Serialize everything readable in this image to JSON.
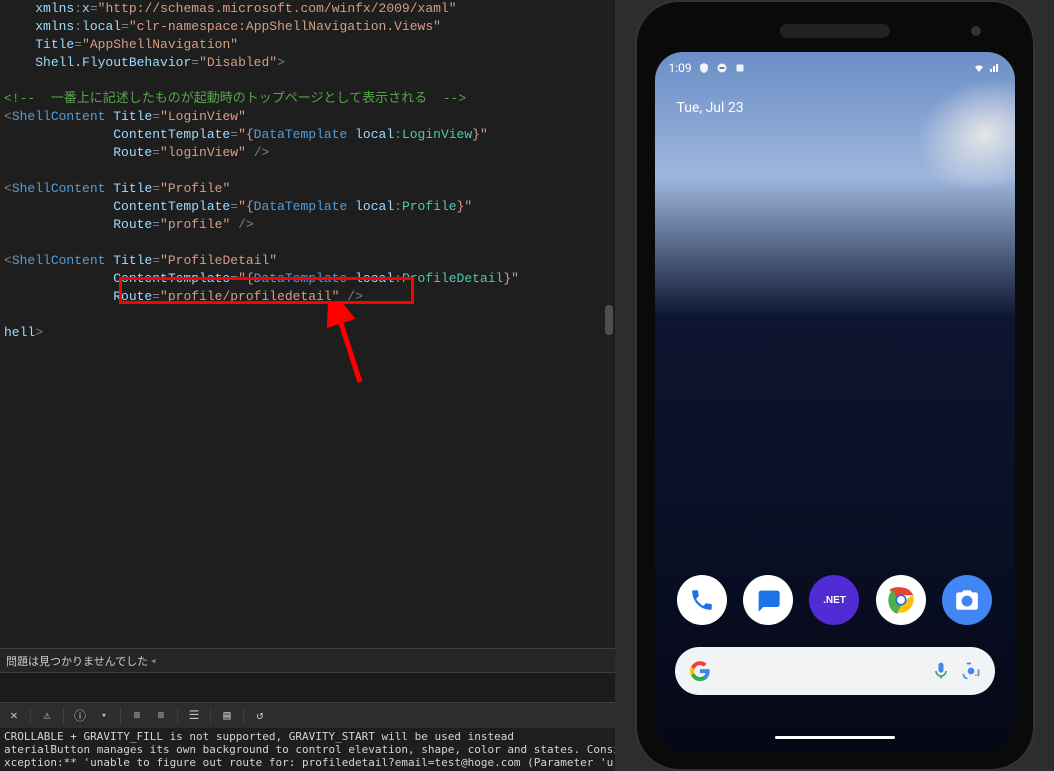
{
  "code": {
    "lines": [
      {
        "indent": "    ",
        "segs": [
          [
            "attr",
            "xmlns"
          ],
          [
            "grey",
            ":"
          ],
          [
            "attr",
            "x"
          ],
          [
            "grey",
            "="
          ],
          [
            "str",
            "\"http://schemas.microsoft.com/winfx/2009/xaml\""
          ]
        ]
      },
      {
        "indent": "    ",
        "segs": [
          [
            "attr",
            "xmlns"
          ],
          [
            "grey",
            ":"
          ],
          [
            "attr",
            "local"
          ],
          [
            "grey",
            "="
          ],
          [
            "str",
            "\"clr-namespace:AppShellNavigation.Views\""
          ]
        ]
      },
      {
        "indent": "    ",
        "segs": [
          [
            "attr",
            "Title"
          ],
          [
            "grey",
            "="
          ],
          [
            "str",
            "\"AppShellNavigation\""
          ]
        ]
      },
      {
        "indent": "    ",
        "segs": [
          [
            "attr",
            "Shell.FlyoutBehavior"
          ],
          [
            "grey",
            "="
          ],
          [
            "str",
            "\"Disabled\""
          ],
          [
            "grey",
            ">"
          ]
        ]
      },
      {
        "indent": "",
        "segs": []
      },
      {
        "indent": "",
        "segs": [
          [
            "comment",
            "<!--  一番上に記述したものが起動時のトップページとして表示される  -->"
          ]
        ]
      },
      {
        "indent": "",
        "segs": [
          [
            "grey",
            "<"
          ],
          [
            "blue",
            "ShellContent"
          ],
          [
            "white",
            " "
          ],
          [
            "attr",
            "Title"
          ],
          [
            "grey",
            "="
          ],
          [
            "str",
            "\"LoginView\""
          ]
        ]
      },
      {
        "indent": "              ",
        "segs": [
          [
            "attr",
            "ContentTemplate"
          ],
          [
            "grey",
            "="
          ],
          [
            "str",
            "\"{"
          ],
          [
            "blue",
            "DataTemplate"
          ],
          [
            "white",
            " "
          ],
          [
            "attr",
            "local"
          ],
          [
            "grey",
            ":"
          ],
          [
            "teal",
            "LoginView"
          ],
          [
            "str",
            "}\""
          ]
        ]
      },
      {
        "indent": "              ",
        "segs": [
          [
            "attr",
            "Route"
          ],
          [
            "grey",
            "="
          ],
          [
            "str",
            "\"loginView\""
          ],
          [
            "white",
            " "
          ],
          [
            "grey",
            "/>"
          ]
        ]
      },
      {
        "indent": "",
        "segs": []
      },
      {
        "indent": "",
        "segs": [
          [
            "grey",
            "<"
          ],
          [
            "blue",
            "ShellContent"
          ],
          [
            "white",
            " "
          ],
          [
            "attr",
            "Title"
          ],
          [
            "grey",
            "="
          ],
          [
            "str",
            "\"Profile\""
          ]
        ]
      },
      {
        "indent": "              ",
        "segs": [
          [
            "attr",
            "ContentTemplate"
          ],
          [
            "grey",
            "="
          ],
          [
            "str",
            "\"{"
          ],
          [
            "blue",
            "DataTemplate"
          ],
          [
            "white",
            " "
          ],
          [
            "attr",
            "local"
          ],
          [
            "grey",
            ":"
          ],
          [
            "teal",
            "Profile"
          ],
          [
            "str",
            "}\""
          ]
        ]
      },
      {
        "indent": "              ",
        "segs": [
          [
            "attr",
            "Route"
          ],
          [
            "grey",
            "="
          ],
          [
            "str",
            "\"profile\""
          ],
          [
            "white",
            " "
          ],
          [
            "grey",
            "/>"
          ]
        ]
      },
      {
        "indent": "",
        "segs": []
      },
      {
        "indent": "",
        "segs": [
          [
            "grey",
            "<"
          ],
          [
            "blue",
            "ShellContent"
          ],
          [
            "white",
            " "
          ],
          [
            "attr",
            "Title"
          ],
          [
            "grey",
            "="
          ],
          [
            "str",
            "\"ProfileDetail\""
          ]
        ]
      },
      {
        "indent": "              ",
        "segs": [
          [
            "attr",
            "ContentTemplate"
          ],
          [
            "grey",
            "="
          ],
          [
            "str",
            "\"{"
          ],
          [
            "blue",
            "DataTemplate"
          ],
          [
            "white",
            " "
          ],
          [
            "attr",
            "local"
          ],
          [
            "grey",
            ":"
          ],
          [
            "teal",
            "ProfileDetail"
          ],
          [
            "str",
            "}\""
          ]
        ]
      },
      {
        "indent": "              ",
        "segs": [
          [
            "attr",
            "Route"
          ],
          [
            "grey",
            "="
          ],
          [
            "str",
            "\"profile/profiledetail\""
          ],
          [
            "white",
            " "
          ],
          [
            "grey",
            "/>"
          ]
        ]
      },
      {
        "indent": "",
        "segs": []
      },
      {
        "indent": "",
        "segs": [
          [
            "attr",
            "hell"
          ],
          [
            "grey",
            ">"
          ]
        ]
      }
    ]
  },
  "status": {
    "text": "問題は見つかりませんでした"
  },
  "output": {
    "line1": "CROLLABLE + GRAVITY_FILL is not supported, GRAVITY_START will be used instead",
    "line2": "aterialButton manages its own background to control elevation, shape, color and states. Consider using ba",
    "line3": "xception:** 'unable to figure out route for: profiledetail?email=test@hoge.com (Parameter 'uri')'"
  },
  "phone": {
    "time": "1:09",
    "date": "Tue, Jul 23",
    "apps": {
      "net_label": ".NET"
    }
  },
  "toolbar": {
    "icons": [
      "errors-icon",
      "separator",
      "warnings-icon",
      "separator",
      "messages-icon",
      "up-down-icon",
      "separator",
      "indent-left-icon",
      "indent-right-icon",
      "separator",
      "comment-out-icon",
      "separator",
      "bookmark-icon",
      "separator",
      "history-icon"
    ]
  }
}
